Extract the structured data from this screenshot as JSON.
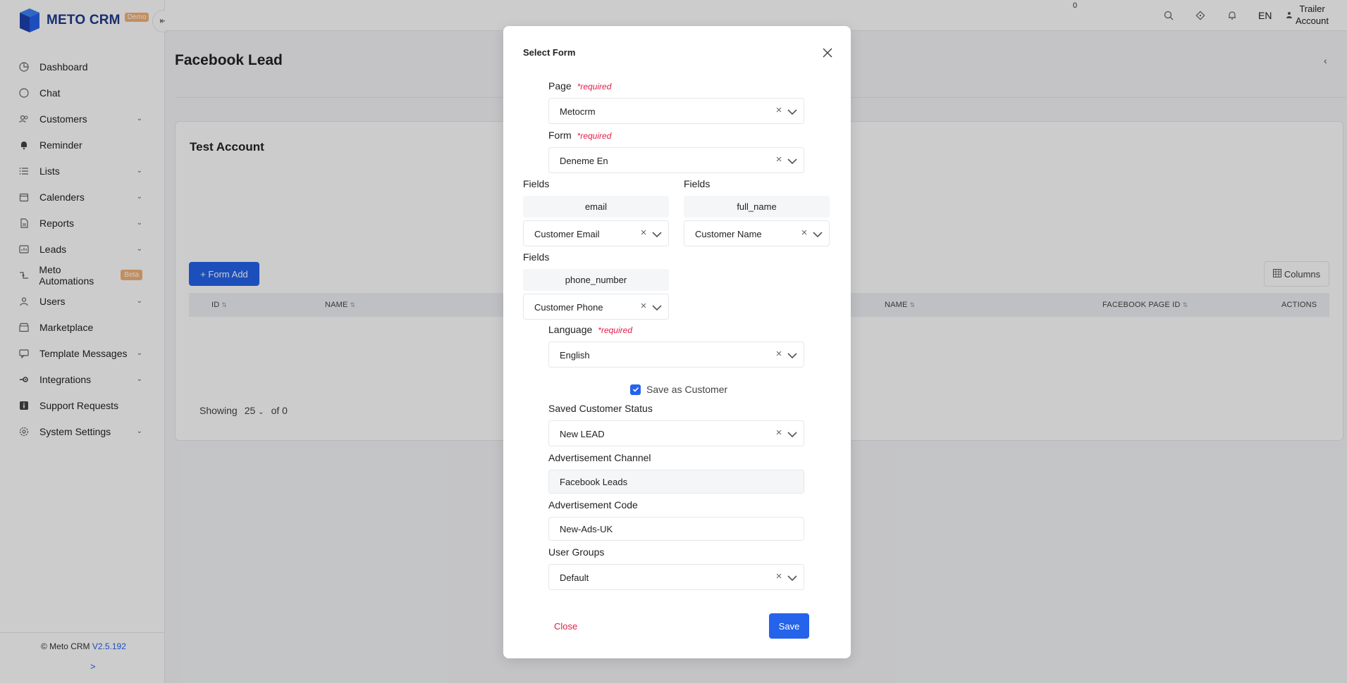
{
  "app": {
    "name": "METO CRM",
    "badge": "Demo"
  },
  "sidebar": {
    "items": [
      {
        "label": "Dashboard",
        "icon": "dashboard-icon"
      },
      {
        "label": "Chat",
        "icon": "chat-icon"
      },
      {
        "label": "Customers",
        "icon": "customers-icon",
        "expandable": true
      },
      {
        "label": "Reminder",
        "icon": "bell-icon"
      },
      {
        "label": "Lists",
        "icon": "list-icon",
        "expandable": true
      },
      {
        "label": "Calenders",
        "icon": "calendar-icon",
        "expandable": true
      },
      {
        "label": "Reports",
        "icon": "report-icon",
        "expandable": true
      },
      {
        "label": "Leads",
        "icon": "leads-icon",
        "expandable": true
      },
      {
        "label": "Meto Automations",
        "icon": "automation-icon",
        "badge": "Beta"
      },
      {
        "label": "Users",
        "icon": "user-icon",
        "expandable": true
      },
      {
        "label": "Marketplace",
        "icon": "marketplace-icon"
      },
      {
        "label": "Template Messages",
        "icon": "message-icon",
        "expandable": true
      },
      {
        "label": "Integrations",
        "icon": "integration-icon",
        "expandable": true
      },
      {
        "label": "Support Requests",
        "icon": "support-icon"
      },
      {
        "label": "System Settings",
        "icon": "gear-icon",
        "expandable": true
      }
    ],
    "footer": {
      "copyright": "© Meto CRM",
      "version": "V2.5.192",
      "expand": ">"
    }
  },
  "topbar": {
    "notification_count": "0",
    "language": "EN",
    "user_line1": "Trailer",
    "user_line2": "Account"
  },
  "page": {
    "title": "Facebook Lead",
    "card_title": "Test Account",
    "form_add_label": "+ Form Add",
    "columns_label": "Columns",
    "table_headers": [
      "ID",
      "NAME",
      "NAME",
      "FACEBOOK PAGE ID",
      "ACTIONS"
    ],
    "showing_label": "Showing",
    "page_size": "25",
    "of_label": "of 0"
  },
  "modal": {
    "title": "Select Form",
    "page_label": "Page",
    "required_text": "*required",
    "page_value": "Metocrm",
    "form_label": "Form",
    "form_value": "Deneme En",
    "fields_label": "Fields",
    "field_mappings": [
      {
        "key": "email",
        "value": "Customer Email"
      },
      {
        "key": "full_name",
        "value": "Customer Name"
      },
      {
        "key": "phone_number",
        "value": "Customer Phone"
      }
    ],
    "language_label": "Language",
    "language_value": "English",
    "save_as_customer_label": "Save as Customer",
    "save_as_customer_checked": true,
    "status_label": "Saved Customer Status",
    "status_value": "New LEAD",
    "channel_label": "Advertisement Channel",
    "channel_value": "Facebook Leads",
    "code_label": "Advertisement Code",
    "code_value": "New-Ads-UK",
    "groups_label": "User Groups",
    "groups_value": "Default",
    "close_label": "Close",
    "save_label": "Save"
  },
  "colors": {
    "primary": "#2563eb",
    "danger": "#e11d48",
    "badge": "#f3b27a",
    "brand": "#1e3a8a"
  }
}
